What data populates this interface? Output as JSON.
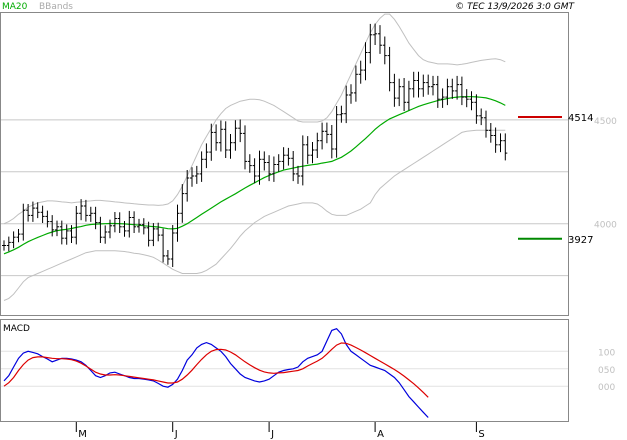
{
  "header": {
    "legend_ma": "MA20",
    "legend_bb": "BBands",
    "copyright": "© TEC 13/9/2026 3:0 GMT"
  },
  "colors": {
    "background": "#ffffff",
    "gridline": "#c8c8c8",
    "price_bar": "#000000",
    "ma20": "#00aa00",
    "bbands": "#c0c0c0",
    "resistance": "#cc0000",
    "support": "#008800",
    "macd_line": "#0000dd",
    "signal_line": "#dd0000",
    "legend_ma": "#00aa00",
    "legend_bb": "#aaaaaa"
  },
  "chart_data": [
    {
      "type": "line",
      "name": "price-panel",
      "y_ticks": [
        {
          "value": 4500,
          "label": "4500"
        },
        {
          "value": 4000,
          "label": "4000"
        }
      ],
      "ylim": [
        3560,
        5020
      ],
      "grid": true,
      "levels": [
        {
          "label": "4514",
          "value": 4514,
          "kind": "resistance"
        },
        {
          "label": "3927",
          "value": 3927,
          "kind": "support"
        }
      ],
      "x_ticks": [
        {
          "index": 15,
          "label": "M"
        },
        {
          "index": 35,
          "label": "J"
        },
        {
          "index": 55,
          "label": "J"
        },
        {
          "index": 77,
          "label": "A"
        },
        {
          "index": 98,
          "label": "S"
        }
      ],
      "n_bars": 105,
      "closes": [
        3895,
        3910,
        3935,
        3950,
        4065,
        4040,
        4075,
        4055,
        4035,
        4010,
        3970,
        3985,
        3930,
        3965,
        3935,
        4050,
        4085,
        4040,
        4050,
        4005,
        3935,
        3960,
        3990,
        4025,
        3985,
        3965,
        4030,
        3985,
        3995,
        3980,
        3920,
        3975,
        3945,
        3845,
        3830,
        3955,
        4050,
        4145,
        4220,
        4230,
        4240,
        4310,
        4345,
        4440,
        4390,
        4455,
        4355,
        4390,
        4460,
        4435,
        4300,
        4280,
        4230,
        4310,
        4295,
        4240,
        4285,
        4300,
        4330,
        4315,
        4240,
        4230,
        4380,
        4330,
        4355,
        4400,
        4445,
        4430,
        4360,
        4525,
        4530,
        4620,
        4630,
        4720,
        4740,
        4825,
        4910,
        4915,
        4860,
        4810,
        4680,
        4605,
        4660,
        4585,
        4650,
        4690,
        4650,
        4680,
        4660,
        4670,
        4600,
        4610,
        4660,
        4640,
        4670,
        4610,
        4600,
        4585,
        4520,
        4510,
        4450,
        4425,
        4380,
        4400,
        4340
      ],
      "ranges": [
        70,
        80,
        80,
        70,
        90,
        85,
        90,
        80,
        90,
        80,
        90,
        85,
        85,
        90,
        80,
        100,
        95,
        85,
        90,
        90,
        80,
        90,
        85,
        90,
        85,
        80,
        90,
        85,
        80,
        90,
        85,
        80,
        85,
        90,
        80,
        110,
        120,
        130,
        110,
        120,
        110,
        110,
        120,
        120,
        110,
        120,
        110,
        120,
        110,
        120,
        110,
        100,
        100,
        120,
        110,
        100,
        110,
        100,
        110,
        100,
        100,
        110,
        130,
        120,
        110,
        110,
        120,
        120,
        130,
        120,
        110,
        130,
        120,
        120,
        130,
        140,
        150,
        140,
        120,
        120,
        120,
        120,
        110,
        120,
        110,
        120,
        120,
        110,
        110,
        120,
        120,
        120,
        110,
        110,
        120,
        110,
        110,
        110,
        110,
        100,
        100,
        100,
        110,
        100,
        100
      ],
      "ma20": [
        3855,
        3864,
        3874,
        3886,
        3900,
        3913,
        3924,
        3934,
        3943,
        3952,
        3960,
        3966,
        3970,
        3973,
        3977,
        3982,
        3986,
        3992,
        3996,
        3998,
        3999,
        4000,
        4001,
        4001,
        4000,
        3999,
        3997,
        3995,
        3993,
        3990,
        3988,
        3986,
        3984,
        3980,
        3976,
        3975,
        3978,
        3988,
        4000,
        4015,
        4030,
        4045,
        4060,
        4075,
        4090,
        4105,
        4118,
        4131,
        4144,
        4158,
        4172,
        4185,
        4197,
        4210,
        4222,
        4232,
        4242,
        4250,
        4258,
        4263,
        4268,
        4273,
        4277,
        4281,
        4284,
        4287,
        4292,
        4296,
        4300,
        4310,
        4320,
        4335,
        4350,
        4370,
        4390,
        4410,
        4432,
        4455,
        4474,
        4490,
        4505,
        4515,
        4525,
        4535,
        4545,
        4555,
        4565,
        4573,
        4580,
        4587,
        4593,
        4598,
        4603,
        4607,
        4610,
        4612,
        4612,
        4612,
        4611,
        4609,
        4606,
        4600,
        4592,
        4582,
        4570
      ],
      "bb_upper": [
        4000,
        4010,
        4025,
        4045,
        4060,
        4080,
        4090,
        4100,
        4105,
        4110,
        4110,
        4108,
        4105,
        4103,
        4100,
        4103,
        4105,
        4108,
        4110,
        4112,
        4112,
        4110,
        4108,
        4105,
        4103,
        4100,
        4098,
        4096,
        4094,
        4092,
        4090,
        4090,
        4088,
        4090,
        4095,
        4110,
        4140,
        4180,
        4230,
        4280,
        4330,
        4380,
        4420,
        4460,
        4500,
        4530,
        4555,
        4570,
        4580,
        4590,
        4595,
        4600,
        4600,
        4597,
        4590,
        4580,
        4570,
        4555,
        4540,
        4525,
        4510,
        4495,
        4490,
        4490,
        4490,
        4490,
        4495,
        4510,
        4540,
        4580,
        4620,
        4670,
        4720,
        4770,
        4820,
        4870,
        4920,
        4960,
        4990,
        5010,
        5010,
        4985,
        4950,
        4910,
        4870,
        4840,
        4810,
        4790,
        4780,
        4775,
        4770,
        4770,
        4770,
        4768,
        4765,
        4768,
        4772,
        4777,
        4782,
        4787,
        4790,
        4793,
        4795,
        4790,
        4780
      ],
      "bb_lower": [
        3630,
        3640,
        3660,
        3690,
        3720,
        3740,
        3750,
        3760,
        3770,
        3780,
        3790,
        3800,
        3810,
        3820,
        3830,
        3840,
        3850,
        3860,
        3865,
        3870,
        3870,
        3870,
        3870,
        3870,
        3868,
        3866,
        3862,
        3858,
        3855,
        3850,
        3845,
        3838,
        3825,
        3810,
        3795,
        3780,
        3770,
        3760,
        3760,
        3760,
        3760,
        3765,
        3775,
        3790,
        3805,
        3830,
        3855,
        3880,
        3910,
        3940,
        3965,
        3985,
        4005,
        4020,
        4035,
        4045,
        4055,
        4065,
        4075,
        4085,
        4090,
        4095,
        4100,
        4100,
        4100,
        4095,
        4080,
        4060,
        4045,
        4040,
        4040,
        4040,
        4050,
        4060,
        4070,
        4085,
        4100,
        4140,
        4170,
        4190,
        4210,
        4230,
        4245,
        4260,
        4275,
        4290,
        4305,
        4320,
        4335,
        4350,
        4365,
        4380,
        4395,
        4410,
        4425,
        4440,
        4445,
        4448,
        4450,
        4450,
        4450,
        4450,
        4450,
        4450,
        4450
      ]
    },
    {
      "type": "line",
      "name": "macd-panel",
      "title": "MACD",
      "y_ticks": [
        {
          "value": 100,
          "label": "100"
        },
        {
          "value": 50,
          "label": "050"
        },
        {
          "value": 0,
          "label": "000"
        }
      ],
      "ylim": [
        -100,
        190
      ],
      "grid": true,
      "series": [
        {
          "role": "macd",
          "values": [
            15,
            30,
            55,
            80,
            95,
            100,
            97,
            93,
            85,
            78,
            70,
            75,
            80,
            80,
            78,
            75,
            70,
            60,
            45,
            30,
            25,
            30,
            38,
            40,
            35,
            30,
            25,
            22,
            22,
            20,
            18,
            15,
            8,
            0,
            -3,
            5,
            20,
            45,
            75,
            90,
            110,
            120,
            125,
            120,
            110,
            100,
            85,
            65,
            50,
            35,
            25,
            20,
            15,
            12,
            15,
            20,
            30,
            40,
            45,
            48,
            50,
            55,
            70,
            80,
            85,
            90,
            100,
            130,
            160,
            165,
            150,
            120,
            100,
            90,
            80,
            70,
            60,
            55,
            50,
            45,
            35,
            25,
            10,
            -10,
            -30,
            -45,
            -60,
            -75,
            -90
          ],
          "start_index": 0
        },
        {
          "role": "signal",
          "values": [
            0,
            10,
            25,
            45,
            62,
            75,
            82,
            84,
            84,
            82,
            80,
            79,
            79,
            78,
            76,
            72,
            66,
            58,
            49,
            40,
            35,
            32,
            32,
            33,
            32,
            30,
            28,
            26,
            24,
            22,
            20,
            18,
            15,
            12,
            9,
            9,
            12,
            20,
            32,
            46,
            62,
            77,
            90,
            100,
            105,
            106,
            104,
            98,
            90,
            80,
            70,
            61,
            53,
            46,
            41,
            38,
            37,
            38,
            39,
            41,
            43,
            45,
            50,
            58,
            65,
            72,
            80,
            92,
            106,
            118,
            124,
            123,
            118,
            111,
            104,
            96,
            88,
            80,
            72,
            64,
            56,
            48,
            39,
            29,
            18,
            7,
            -5,
            -18,
            -32
          ],
          "start_index": 0
        }
      ]
    }
  ]
}
